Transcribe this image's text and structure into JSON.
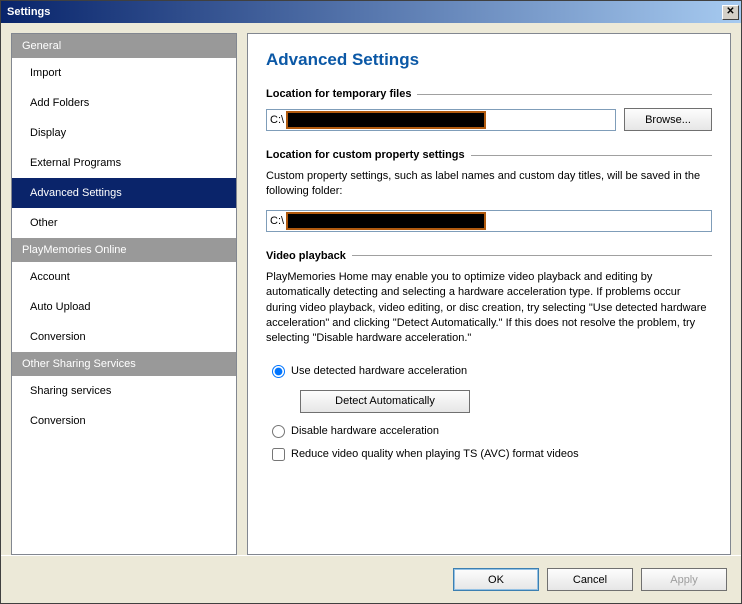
{
  "window": {
    "title": "Settings"
  },
  "sidebar": {
    "groups": [
      {
        "header": "General",
        "items": [
          {
            "label": "Import",
            "selected": false
          },
          {
            "label": "Add Folders",
            "selected": false
          },
          {
            "label": "Display",
            "selected": false
          },
          {
            "label": "External Programs",
            "selected": false
          },
          {
            "label": "Advanced Settings",
            "selected": true
          },
          {
            "label": "Other",
            "selected": false
          }
        ]
      },
      {
        "header": "PlayMemories Online",
        "items": [
          {
            "label": "Account",
            "selected": false
          },
          {
            "label": "Auto Upload",
            "selected": false
          },
          {
            "label": "Conversion",
            "selected": false
          }
        ]
      },
      {
        "header": "Other Sharing Services",
        "items": [
          {
            "label": "Sharing services",
            "selected": false
          },
          {
            "label": "Conversion",
            "selected": false
          }
        ]
      }
    ]
  },
  "content": {
    "title": "Advanced Settings",
    "temp_files": {
      "header": "Location for temporary files",
      "prefix": "C:\\",
      "browse": "Browse..."
    },
    "custom_props": {
      "header": "Location for custom property settings",
      "desc": "Custom property settings, such as label names and custom day titles, will be saved in the following folder:",
      "prefix": "C:\\"
    },
    "video": {
      "header": "Video playback",
      "desc": "PlayMemories Home may enable you to optimize video playback and editing by automatically detecting and selecting a hardware acceleration type. If problems occur during video playback, video editing, or disc creation, try selecting \"Use detected hardware acceleration\" and clicking \"Detect Automatically.\" If this does not resolve the problem, try selecting \"Disable hardware acceleration.\"",
      "radio_use_detected": "Use detected hardware acceleration",
      "detect_button": "Detect Automatically",
      "radio_disable": "Disable hardware acceleration",
      "checkbox_reduce": "Reduce video quality when playing TS (AVC) format videos",
      "selected_radio": "use_detected",
      "reduce_checked": false
    }
  },
  "footer": {
    "ok": "OK",
    "cancel": "Cancel",
    "apply": "Apply"
  }
}
